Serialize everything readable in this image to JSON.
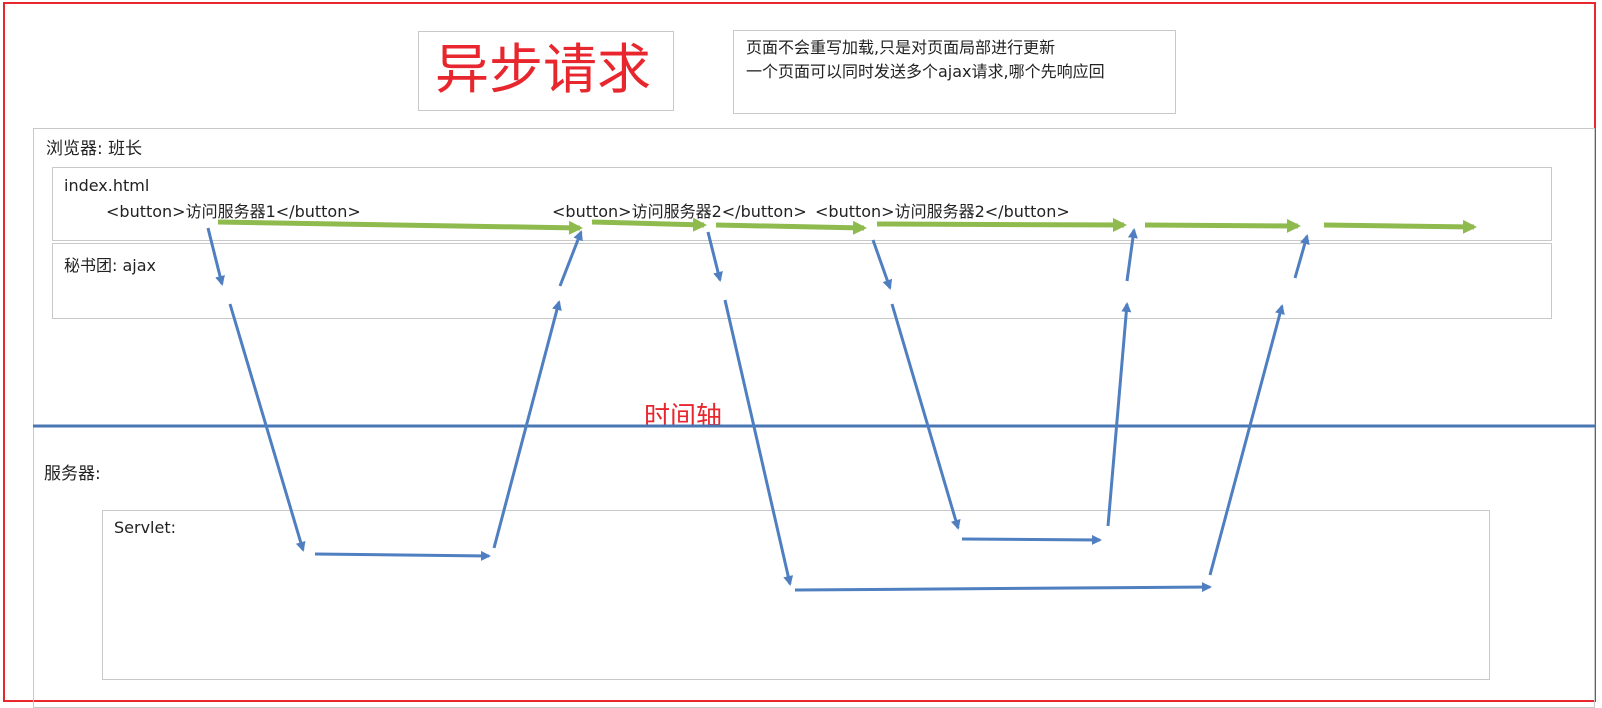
{
  "title": "异步请求",
  "notes": [
    "页面不会重写加载,只是对页面局部进行更新",
    "一个页面可以同时发送多个ajax请求,哪个先响应回"
  ],
  "browser": {
    "label": "浏览器: 班长",
    "index_box": {
      "label": "index.html",
      "buttons": [
        "<button>访问服务器1</button>",
        "<button>访问服务器2</button>",
        "<button>访问服务器2</button>"
      ]
    },
    "ajax_box": {
      "label": "秘书团: ajax"
    }
  },
  "timeline_label": "时间轴",
  "server": {
    "label": "服务器:",
    "servlet_label": "Servlet:"
  },
  "colors": {
    "border_red": "#e8262d",
    "title_red": "#e8262d",
    "timeline_blue": "#4a77b4",
    "request_blue": "#4f7fc0",
    "browser_green": "#8fba4e"
  }
}
